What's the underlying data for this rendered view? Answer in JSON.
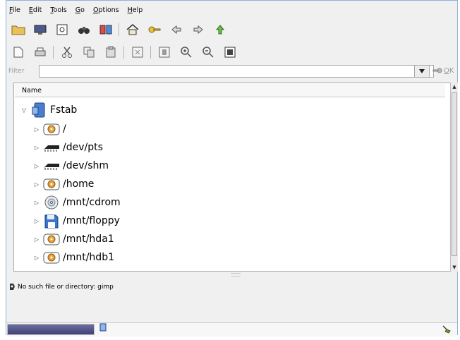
{
  "menu": {
    "items": [
      {
        "label": "File"
      },
      {
        "label": "Edit"
      },
      {
        "label": "Tools"
      },
      {
        "label": "Go"
      },
      {
        "label": "Options"
      },
      {
        "label": "Help"
      }
    ]
  },
  "toolbar1": {
    "icons": [
      "folder-icon",
      "monitor-icon",
      "bookmark-page-icon",
      "binoculars-icon",
      "book-icon",
      "home-icon",
      "key-icon",
      "back-arrow-icon",
      "forward-arrow-icon",
      "up-arrow-icon"
    ]
  },
  "toolbar2": {
    "icons": [
      "new-document-icon",
      "print-icon",
      "cut-icon",
      "copy-icon",
      "paste-icon",
      "delete-icon",
      "properties-icon",
      "zoom-in-icon",
      "zoom-out-icon",
      "view-icon"
    ]
  },
  "filter": {
    "label": "Filter",
    "value": "",
    "ok_label": "OK"
  },
  "tree": {
    "column_header": "Name",
    "root": {
      "label": "Fstab",
      "expanded": true
    },
    "items": [
      {
        "label": "/",
        "icon": "harddisk-icon"
      },
      {
        "label": "/dev/pts",
        "icon": "memory-chip-icon"
      },
      {
        "label": "/dev/shm",
        "icon": "memory-chip-icon"
      },
      {
        "label": "/home",
        "icon": "harddisk-icon"
      },
      {
        "label": "/mnt/cdrom",
        "icon": "cdrom-icon"
      },
      {
        "label": "/mnt/floppy",
        "icon": "floppy-icon"
      },
      {
        "label": "/mnt/hda1",
        "icon": "harddisk-icon"
      },
      {
        "label": "/mnt/hdb1",
        "icon": "harddisk-icon"
      }
    ]
  },
  "status": {
    "message": "No such file or directory: gimp"
  },
  "bottom": {
    "progress_fraction": 1.0
  },
  "colors": {
    "frame_border": "#8fb3d9",
    "progress": "#4a4c85",
    "disk_orange": "#e8a23c"
  }
}
